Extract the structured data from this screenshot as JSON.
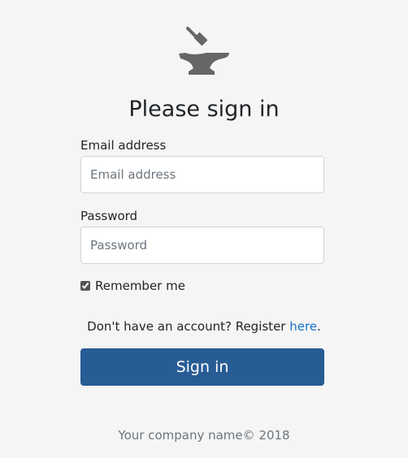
{
  "logo": {
    "icon": "anvil-hammer-icon",
    "color": "#666666"
  },
  "heading": {
    "title": "Please sign in"
  },
  "form": {
    "email_label": "Email address",
    "email_placeholder": "Email address",
    "email_value": "",
    "password_label": "Password",
    "password_placeholder": "Password",
    "password_value": "",
    "remember_label": "Remember me",
    "remember_checked": true
  },
  "register": {
    "prefix": "Don't have an account? Register ",
    "link_text": "here",
    "suffix": "."
  },
  "submit": {
    "label": "Sign in",
    "color": "#285c95"
  },
  "footer": {
    "text": "Your company name© 2018"
  }
}
